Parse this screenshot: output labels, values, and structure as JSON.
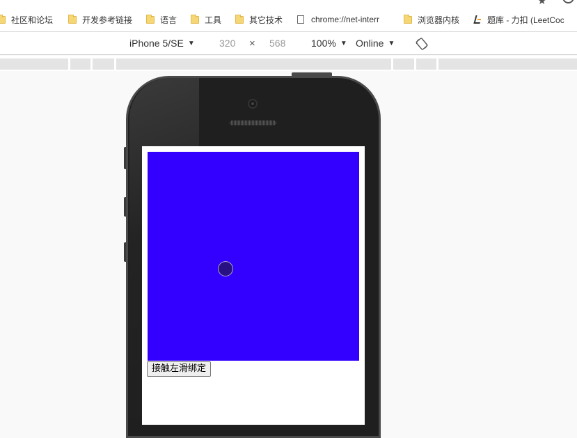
{
  "bookmarks": [
    {
      "label": "社区和论坛",
      "icon": "folder-icon"
    },
    {
      "label": "开发参考链接",
      "icon": "folder-icon"
    },
    {
      "label": "语言",
      "icon": "folder-icon"
    },
    {
      "label": "工具",
      "icon": "folder-icon"
    },
    {
      "label": "其它技术",
      "icon": "folder-icon"
    },
    {
      "label": "chrome://net-interr",
      "icon": "page-icon"
    },
    {
      "label": "浏览器内核",
      "icon": "folder-icon"
    },
    {
      "label": "题库 - 力扣 (LeetCoc",
      "icon": "leetcode-icon"
    }
  ],
  "device_toolbar": {
    "device": "iPhone 5/SE",
    "width": "320",
    "height": "568",
    "zoom": "100%",
    "network": "Online",
    "times_symbol": "×",
    "caret_symbol": "▼"
  },
  "page": {
    "touch_box_color": "#3300ff",
    "button_label": "接触左滑绑定"
  }
}
